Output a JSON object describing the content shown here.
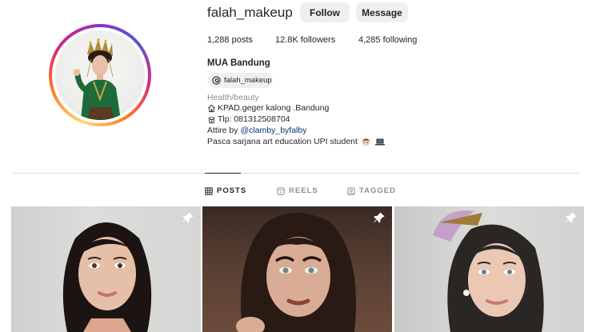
{
  "profile": {
    "username": "falah_makeup",
    "follow_label": "Follow",
    "message_label": "Message",
    "stats": {
      "posts": "1,288 posts",
      "followers": "12.8K followers",
      "following": "4,285 following"
    },
    "full_name": "MUA Bandung",
    "threads_handle": "falah_makeup",
    "category": "Health/beauty",
    "bio": {
      "address": "KPAD.geger kalong .Bandung",
      "tip": "Tlp: 081312508704",
      "attire_prefix": "Attire by ",
      "attire_mention": "@clamby_byfalby",
      "education": "Pasca sarjana art education UPI student"
    }
  },
  "tabs": [
    {
      "label": "POSTS",
      "icon": "grid-icon",
      "active": true
    },
    {
      "label": "REELS",
      "icon": "reels-icon",
      "active": false
    },
    {
      "label": "TAGGED",
      "icon": "tagged-icon",
      "active": false
    }
  ],
  "posts": [
    {
      "pinned": true,
      "pin_icon": "pin-icon"
    },
    {
      "pinned": true,
      "pin_icon": "pin-icon"
    },
    {
      "pinned": true,
      "pin_icon": "pin-icon"
    }
  ],
  "colors": {
    "text": "#262626",
    "secondary": "#8e8e8e",
    "button_bg": "#efefef",
    "mention": "#00376b",
    "divider": "#dbdbdb"
  }
}
